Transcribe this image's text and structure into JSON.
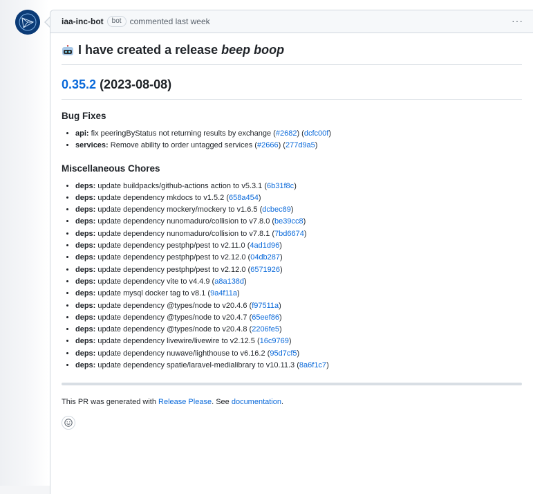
{
  "header": {
    "author": "iaa-inc-bot",
    "badge": "bot",
    "action": "commented last week",
    "menu": "···"
  },
  "comment": {
    "title_plain": "I have created a release",
    "title_em": "beep boop",
    "version_link": "0.35.2",
    "version_date": "(2023-08-08)",
    "sections": [
      {
        "heading": "Bug Fixes",
        "items": [
          {
            "scope": "api:",
            "text": "fix peeringByStatus not returning results by exchange",
            "pr": "#2682",
            "commit": "dcfc00f"
          },
          {
            "scope": "services:",
            "text": "Remove ability to order untagged services",
            "pr": "#2666",
            "commit": "277d9a5"
          }
        ]
      },
      {
        "heading": "Miscellaneous Chores",
        "items": [
          {
            "scope": "deps:",
            "text": "update buildpacks/github-actions action to v5.3.1",
            "pr": "",
            "commit": "6b31f8c"
          },
          {
            "scope": "deps:",
            "text": "update dependency mkdocs to v1.5.2",
            "pr": "",
            "commit": "658a454"
          },
          {
            "scope": "deps:",
            "text": "update dependency mockery/mockery to v1.6.5",
            "pr": "",
            "commit": "dcbec89"
          },
          {
            "scope": "deps:",
            "text": "update dependency nunomaduro/collision to v7.8.0",
            "pr": "",
            "commit": "be39cc8"
          },
          {
            "scope": "deps:",
            "text": "update dependency nunomaduro/collision to v7.8.1",
            "pr": "",
            "commit": "7bd6674"
          },
          {
            "scope": "deps:",
            "text": "update dependency pestphp/pest to v2.11.0",
            "pr": "",
            "commit": "4ad1d96"
          },
          {
            "scope": "deps:",
            "text": "update dependency pestphp/pest to v2.12.0",
            "pr": "",
            "commit": "04db287"
          },
          {
            "scope": "deps:",
            "text": "update dependency pestphp/pest to v2.12.0",
            "pr": "",
            "commit": "6571926"
          },
          {
            "scope": "deps:",
            "text": "update dependency vite to v4.4.9",
            "pr": "",
            "commit": "a8a138d"
          },
          {
            "scope": "deps:",
            "text": "update mysql docker tag to v8.1",
            "pr": "",
            "commit": "9a4f11a"
          },
          {
            "scope": "deps:",
            "text": "update dependency @types/node to v20.4.6",
            "pr": "",
            "commit": "f97511a"
          },
          {
            "scope": "deps:",
            "text": "update dependency @types/node to v20.4.7",
            "pr": "",
            "commit": "65eef86"
          },
          {
            "scope": "deps:",
            "text": "update dependency @types/node to v20.4.8",
            "pr": "",
            "commit": "2206fe5"
          },
          {
            "scope": "deps:",
            "text": "update dependency livewire/livewire to v2.12.5",
            "pr": "",
            "commit": "16c9769"
          },
          {
            "scope": "deps:",
            "text": "update dependency nuwave/lighthouse to v6.16.2",
            "pr": "",
            "commit": "95d7cf5"
          },
          {
            "scope": "deps:",
            "text": "update dependency spatie/laravel-medialibrary to v10.11.3",
            "pr": "",
            "commit": "8a6f1c7"
          }
        ]
      }
    ],
    "footer_prefix": "This PR was generated with",
    "footer_link1": "Release Please",
    "footer_mid": ". See",
    "footer_link2": "documentation",
    "footer_suffix": "."
  },
  "icons": {
    "avatar": "organization-avatar",
    "title": "robot-icon",
    "reaction": "smiley-icon"
  }
}
